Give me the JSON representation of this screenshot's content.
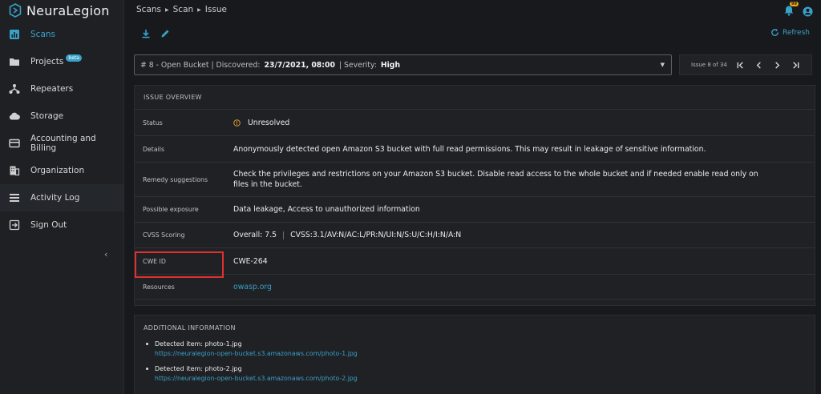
{
  "app": {
    "brand": "NeuraLegion"
  },
  "sidebar": {
    "items": [
      {
        "label": "Scans",
        "icon": "chart-icon",
        "active": true
      },
      {
        "label": "Projects",
        "icon": "folder-icon",
        "badge": "beta"
      },
      {
        "label": "Repeaters",
        "icon": "nodes-icon"
      },
      {
        "label": "Storage",
        "icon": "cloud-icon"
      },
      {
        "label": "Accounting and Billing",
        "icon": "credit-card-icon"
      },
      {
        "label": "Organization",
        "icon": "building-icon"
      },
      {
        "label": "Activity Log",
        "icon": "list-icon"
      },
      {
        "label": "Sign Out",
        "icon": "sign-out-icon"
      }
    ]
  },
  "breadcrumb": [
    "Scans",
    "Scan",
    "Issue"
  ],
  "notifications": {
    "count": "99"
  },
  "toolbar": {
    "refresh_label": "Refresh"
  },
  "issue_selector": {
    "prefix": "# 8 - Open Bucket | Discovered:",
    "discovered": "23/7/2021, 08:00",
    "severity_prefix": "| Severity:",
    "severity": "High"
  },
  "pager": {
    "label": "Issue 8 of 34"
  },
  "overview": {
    "header": "ISSUE OVERVIEW",
    "status": {
      "label": "Status",
      "value": "Unresolved"
    },
    "details": {
      "label": "Details",
      "value": "Anonymously detected open Amazon S3 bucket with full read permissions. This may result in leakage of sensitive information."
    },
    "remedy": {
      "label": "Remedy suggestions",
      "value": "Check the privileges and restrictions on your Amazon S3 bucket. Disable read access to the whole bucket and if needed enable read only on files in the bucket."
    },
    "exposure": {
      "label": "Possible exposure",
      "value": "Data leakage, Access to unauthorized information"
    },
    "cvss": {
      "label": "CVSS Scoring",
      "overall": "Overall: 7.5",
      "vector": "CVSS:3.1/AV:N/AC:L/PR:N/UI:N/S:U/C:H/I:N/A:N"
    },
    "cwe": {
      "label": "CWE ID",
      "value": "CWE-264"
    },
    "resources": {
      "label": "Resources",
      "value": "owasp.org"
    }
  },
  "additional": {
    "header": "ADDITIONAL INFORMATION",
    "items": [
      {
        "label": "Detected item: photo-1.jpg",
        "url": "https://neuralegion-open-bucket.s3.amazonaws.com/photo-1.jpg"
      },
      {
        "label": "Detected item: photo-2.jpg",
        "url": "https://neuralegion-open-bucket.s3.amazonaws.com/photo-2.jpg"
      }
    ]
  },
  "colors": {
    "accent": "#38a2c9",
    "highlight_box": "#e0312f",
    "status_warning": "#e0a030"
  }
}
